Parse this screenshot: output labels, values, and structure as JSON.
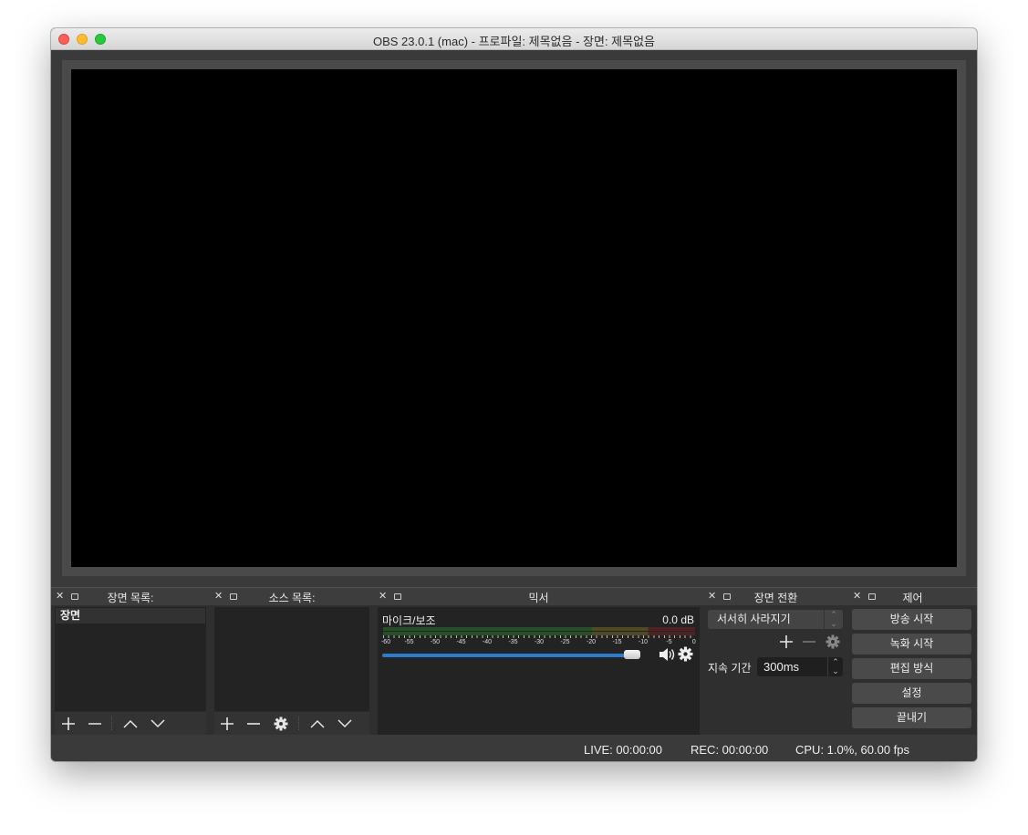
{
  "window": {
    "title": "OBS 23.0.1 (mac) - 프로파일: 제목없음 - 장면: 제목없음"
  },
  "docks": {
    "scenes": {
      "title": "장면 목록:",
      "items": [
        "장면"
      ]
    },
    "sources": {
      "title": "소스 목록:"
    },
    "mixer": {
      "title": "믹서",
      "tracks": [
        {
          "name": "마이크/보조",
          "level": "0.0 dB",
          "volume_fraction": 0.95,
          "ticks": [
            "-60",
            "-55",
            "-50",
            "-45",
            "-40",
            "-35",
            "-30",
            "-25",
            "-20",
            "-15",
            "-10",
            "-5",
            "0"
          ]
        }
      ]
    },
    "transitions": {
      "title": "장면 전환",
      "selected": "서서히 사라지기",
      "duration_label": "지속 기간",
      "duration_value": "300ms"
    },
    "controls": {
      "title": "제어",
      "buttons": [
        "방송 시작",
        "녹화 시작",
        "편집 방식",
        "설정",
        "끝내기"
      ]
    }
  },
  "status": {
    "live": "LIVE: 00:00:00",
    "rec": "REC: 00:00:00",
    "cpu": "CPU: 1.0%, 60.00 fps"
  },
  "colors": {
    "accent": "#2e7ad0",
    "meter_green": "#264f26",
    "meter_yellow": "#4f4a23",
    "meter_red": "#4f2323",
    "background": "#3a3a3a"
  },
  "icons": {
    "add": "plus-icon",
    "remove": "minus-icon",
    "up": "chevron-up-icon",
    "down": "chevron-down-icon",
    "settings": "gear-icon",
    "speaker": "speaker-icon"
  }
}
